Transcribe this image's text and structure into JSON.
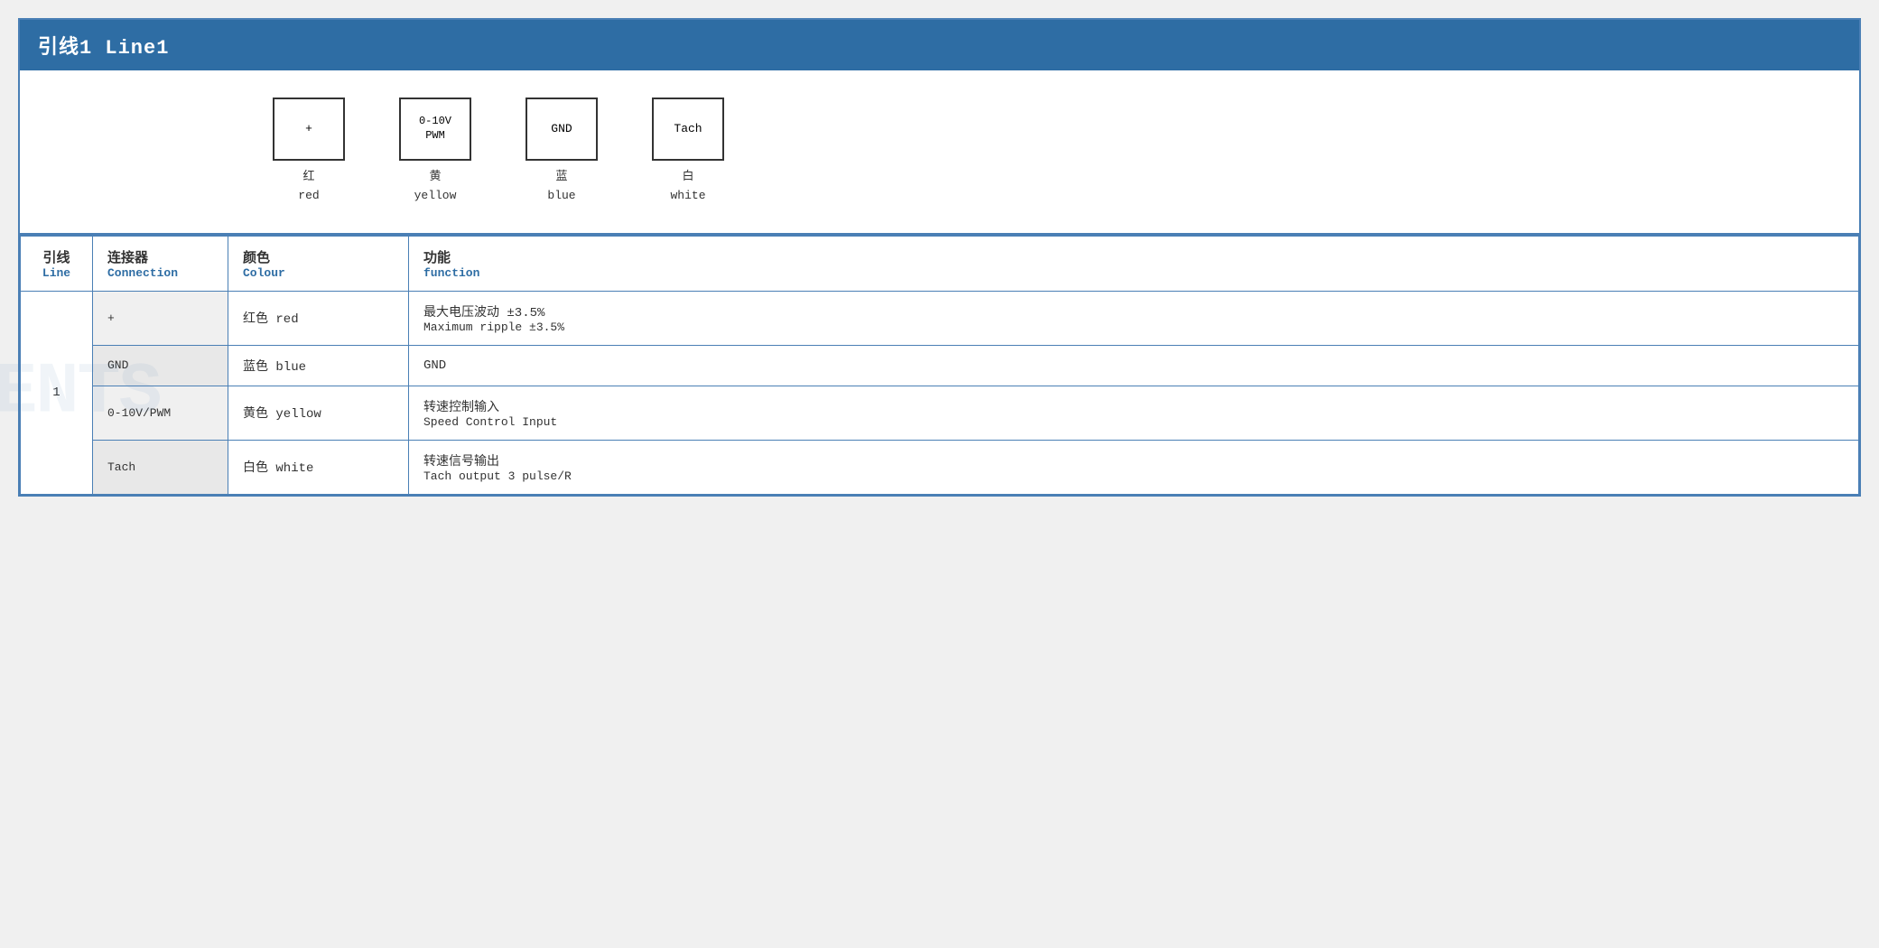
{
  "header": {
    "title": "引线1 Line1"
  },
  "diagram": {
    "connectors": [
      {
        "id": "plus",
        "box_label": "+",
        "label_chinese": "红",
        "label_english": "red"
      },
      {
        "id": "pwm",
        "box_label": "0-10V\nPWM",
        "label_chinese": "黄",
        "label_english": "yellow"
      },
      {
        "id": "gnd",
        "box_label": "GND",
        "label_chinese": "蓝",
        "label_english": "blue"
      },
      {
        "id": "tach",
        "box_label": "Tach",
        "label_chinese": "白",
        "label_english": "white"
      }
    ]
  },
  "table": {
    "headers": {
      "line_chinese": "引线",
      "line_english": "Line",
      "connection_chinese": "连接器",
      "connection_english": "Connection",
      "colour_chinese": "颜色",
      "colour_english": "Colour",
      "function_chinese": "功能",
      "function_english": "function"
    },
    "rows": [
      {
        "line": "1",
        "connection": "+",
        "colour_chinese": "红色 red",
        "func_chinese": "最大电压波动 ±3.5%",
        "func_english": "Maximum ripple ±3.5%"
      },
      {
        "line": "",
        "connection": "GND",
        "colour_chinese": "蓝色 blue",
        "func_chinese": "GND",
        "func_english": ""
      },
      {
        "line": "",
        "connection": "0-10V/PWM",
        "colour_chinese": "黄色 yellow",
        "func_chinese": "转速控制输入",
        "func_english": "Speed Control Input"
      },
      {
        "line": "",
        "connection": "Tach",
        "colour_chinese": "白色 white",
        "func_chinese": "转速信号输出",
        "func_english": "Tach output 3 pulse/R"
      }
    ]
  }
}
